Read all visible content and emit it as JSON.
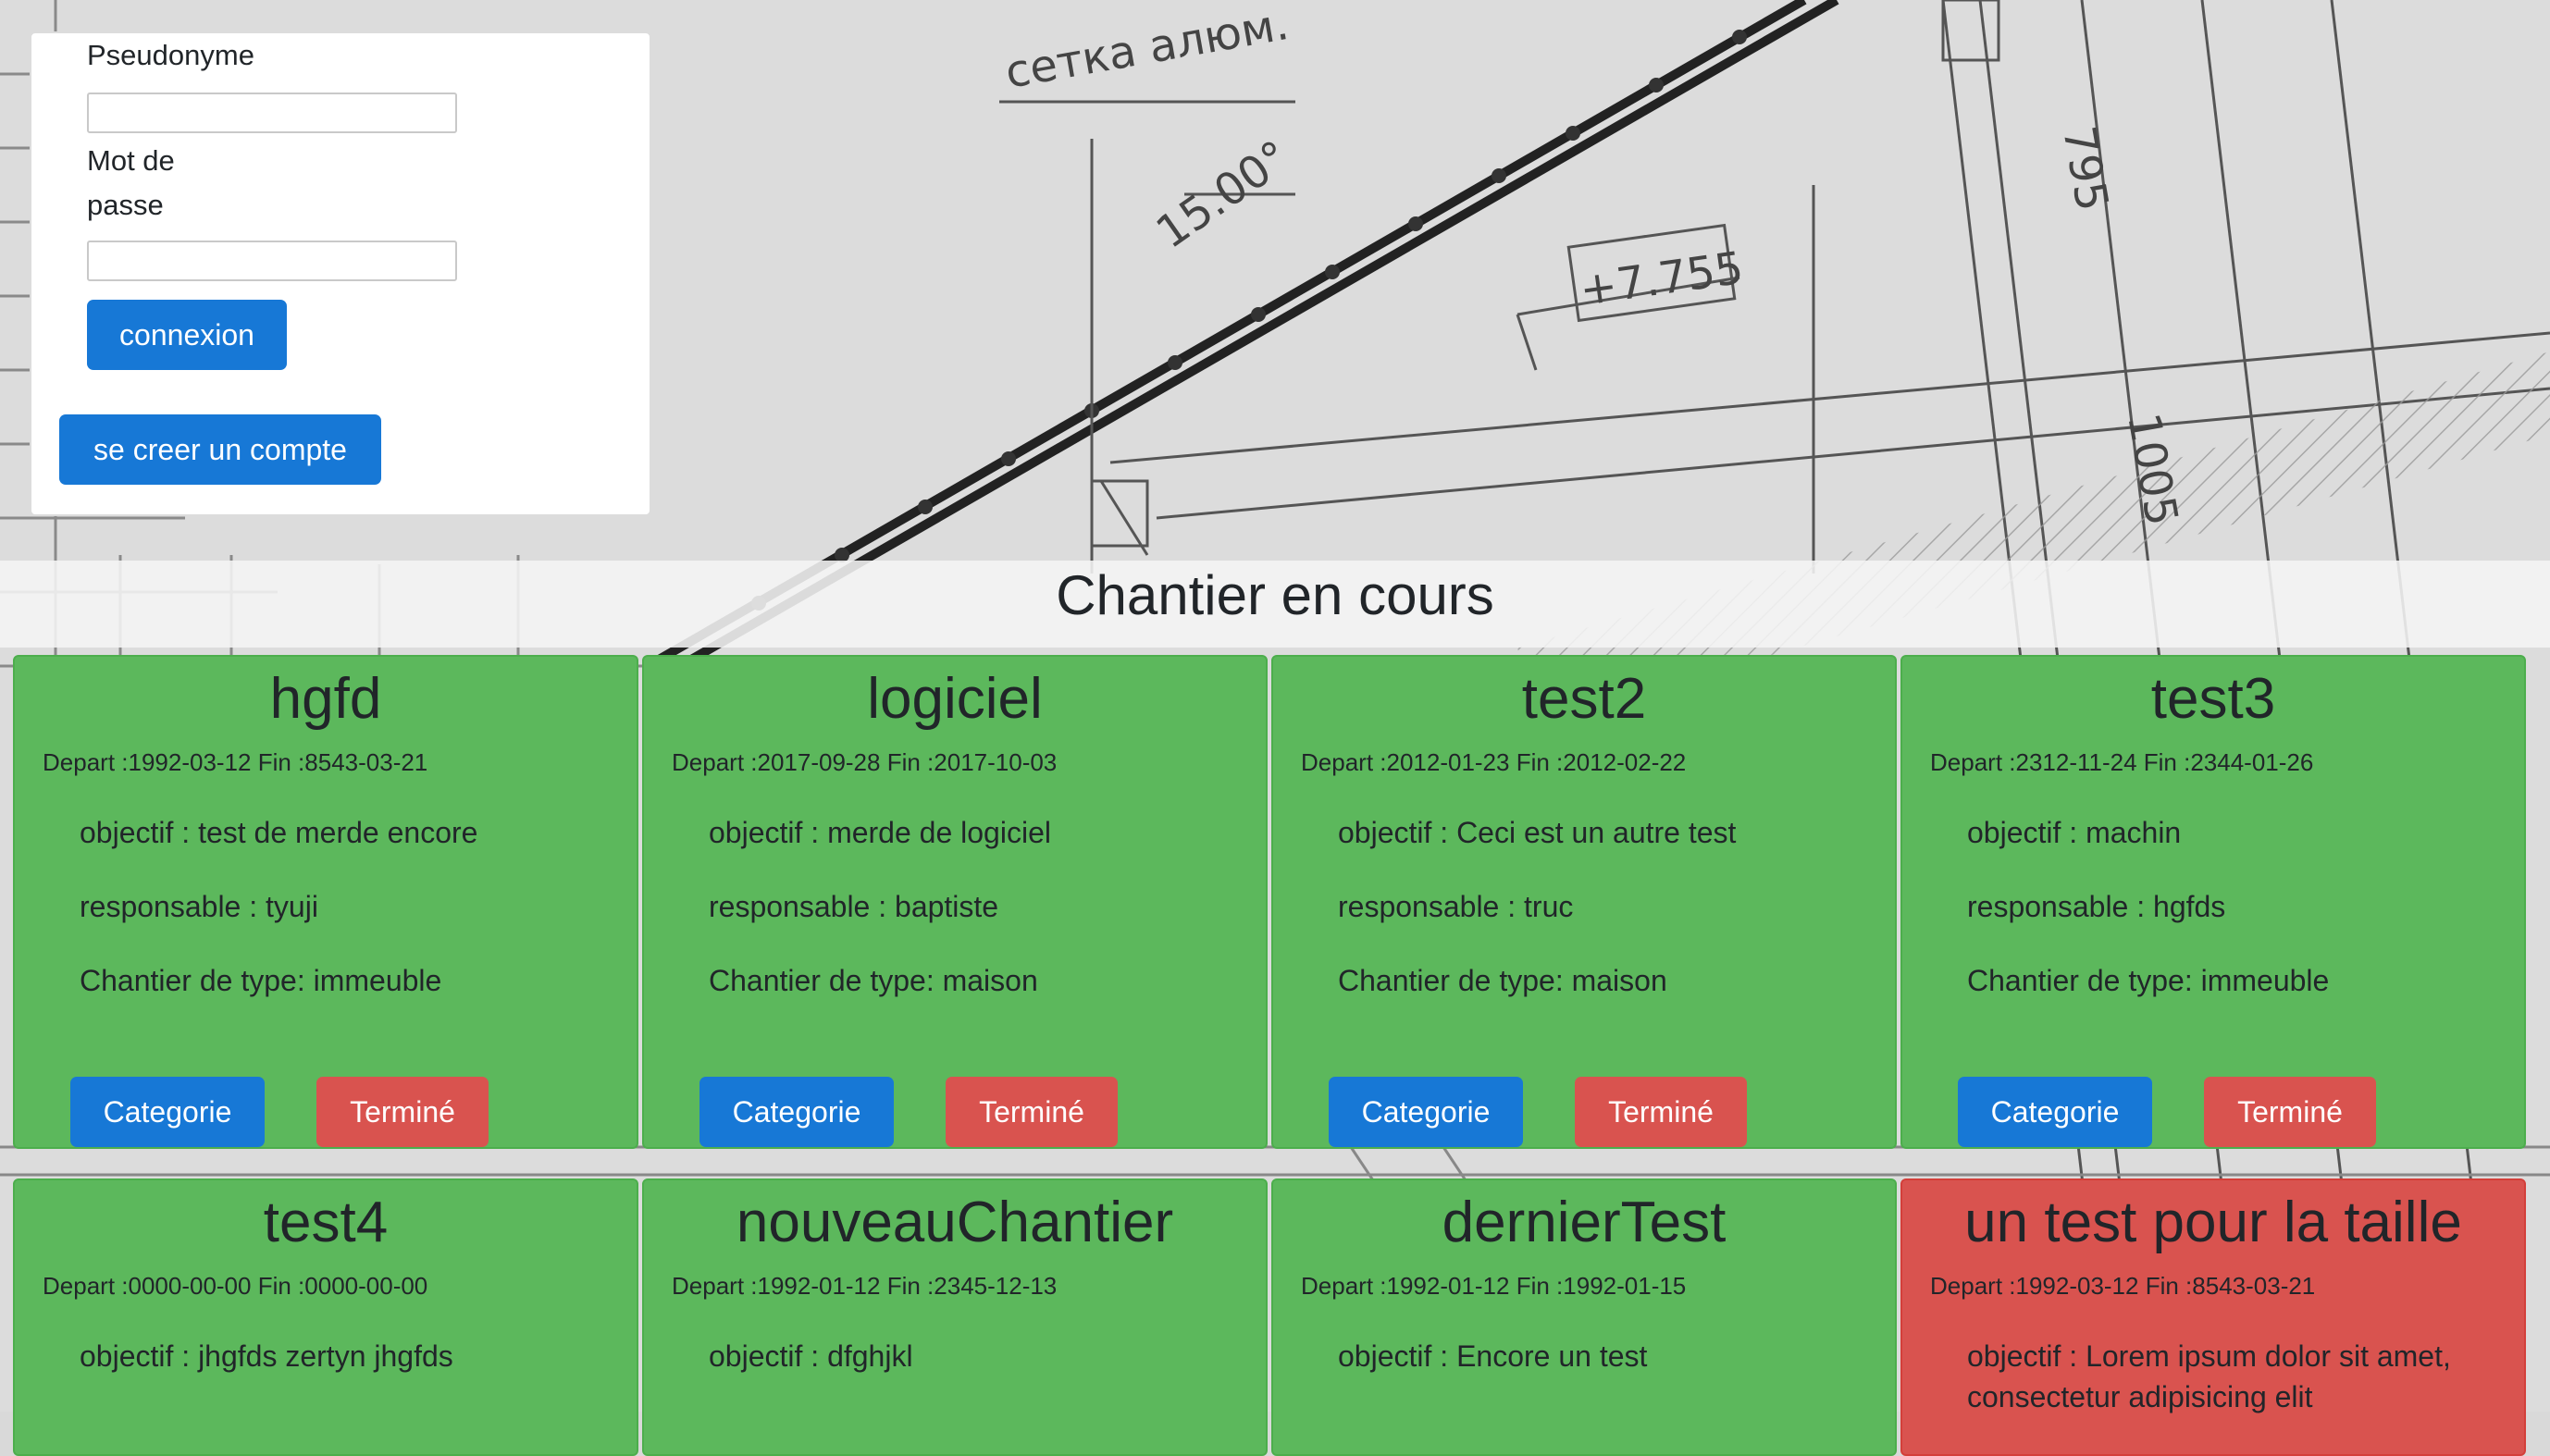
{
  "login": {
    "pseudonyme_label": "Pseudonyme",
    "password_label_line1": "Mot de",
    "password_label_line2": "passe",
    "pseudonyme_value": "",
    "password_value": "",
    "connexion_button": "connexion",
    "create_account_button": "se creer un compte"
  },
  "section_title": "Chantier en cours",
  "labels": {
    "depart": "Depart :",
    "fin": " Fin :",
    "objectif": "objectif : ",
    "responsable": "responsable : ",
    "type": "Chantier de type: ",
    "categorie_button": "Categorie",
    "termine_button": "Terminé"
  },
  "colors": {
    "card_active": "#5cb85c",
    "card_alert": "#d9534f",
    "button_primary": "#1778d6",
    "button_danger": "#d9534f"
  },
  "chantiers": [
    {
      "name": "hgfd",
      "depart": "1992-03-12",
      "fin": "8543-03-21",
      "objectif": "test de merde encore",
      "responsable": "tyuji",
      "type": "immeuble",
      "status": "green"
    },
    {
      "name": "logiciel",
      "depart": "2017-09-28",
      "fin": "2017-10-03",
      "objectif": "merde de logiciel",
      "responsable": "baptiste",
      "type": "maison",
      "status": "green"
    },
    {
      "name": "test2",
      "depart": "2012-01-23",
      "fin": "2012-02-22",
      "objectif": "Ceci est un autre test",
      "responsable": "truc",
      "type": "maison",
      "status": "green"
    },
    {
      "name": "test3",
      "depart": "2312-11-24",
      "fin": "2344-01-26",
      "objectif": "machin",
      "responsable": "hgfds",
      "type": "immeuble",
      "status": "green"
    },
    {
      "name": "test4",
      "depart": "0000-00-00",
      "fin": "0000-00-00",
      "objectif": "jhgfds zertyn jhgfds",
      "status": "green"
    },
    {
      "name": "nouveauChantier",
      "depart": "1992-01-12",
      "fin": "2345-12-13",
      "objectif": "dfghjkl",
      "status": "green"
    },
    {
      "name": "dernierTest",
      "depart": "1992-01-12",
      "fin": "1992-01-15",
      "objectif": "Encore un test",
      "status": "green"
    },
    {
      "name": "un test pour la taille",
      "depart": "1992-03-12",
      "fin": "8543-03-21",
      "objectif": "Lorem ipsum dolor sit amet, consectetur adipisicing elit",
      "status": "red"
    }
  ]
}
